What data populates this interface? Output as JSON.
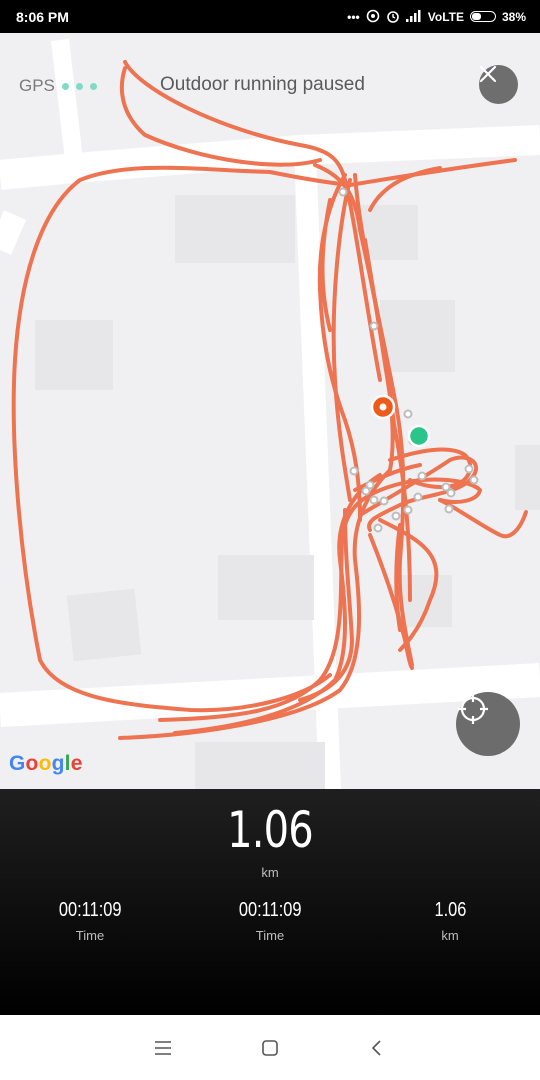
{
  "status_bar": {
    "time": "8:06 PM",
    "icons": [
      "more-dots-icon",
      "hotspot-icon",
      "alarm-icon",
      "signal-icon"
    ],
    "network": "VoLTE",
    "battery": "38%",
    "battery_level": 0.38
  },
  "map": {
    "gps_label": "GPS",
    "title": "Outdoor running paused",
    "attribution": "Google",
    "route_color": "#ee7351",
    "start_marker_color": "#ee5a1a",
    "current_marker_color": "#2bc48a"
  },
  "stats": {
    "distance_value": "1.06",
    "distance_unit": "km",
    "items": [
      {
        "value": "00:11:09",
        "label": "Time"
      },
      {
        "value": "00:11:09",
        "label": "Time"
      },
      {
        "value": "1.06",
        "label": "km"
      }
    ]
  },
  "nav": {
    "icons": [
      "menu-icon",
      "home-icon",
      "back-icon"
    ]
  }
}
